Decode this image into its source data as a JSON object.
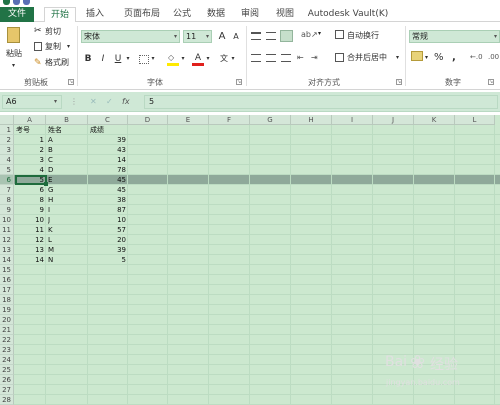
{
  "ribbon": {
    "tabs": [
      "文件",
      "开始",
      "插入",
      "页面布局",
      "公式",
      "数据",
      "审阅",
      "视图",
      "Autodesk Vault(K)"
    ],
    "clipboard": {
      "paste": "粘贴",
      "cut": "剪切",
      "copy": "复制",
      "format_painter": "格式刷",
      "label": "剪贴板"
    },
    "font": {
      "name": "宋体",
      "size": "11",
      "grow": "A",
      "shrink": "A",
      "bold": "B",
      "italic": "I",
      "underline": "U",
      "font_color_letter": "A",
      "wen": "文",
      "label": "字体"
    },
    "alignment": {
      "wrap": "自动换行",
      "merge": "合并后居中",
      "label": "对齐方式"
    },
    "number": {
      "format": "常规",
      "percent": "%",
      "comma": ",",
      "label": "数字"
    }
  },
  "formula_bar": {
    "name_box": "A6",
    "fx": "fx",
    "value": "5"
  },
  "columns": [
    "A",
    "B",
    "C",
    "D",
    "E",
    "F",
    "G",
    "H",
    "I",
    "J",
    "K",
    "L"
  ],
  "rows": [
    "1",
    "2",
    "3",
    "4",
    "5",
    "6",
    "7",
    "8",
    "9",
    "10",
    "11",
    "12",
    "13",
    "14",
    "15",
    "16",
    "17",
    "18",
    "19",
    "20",
    "21",
    "22",
    "23",
    "24",
    "25",
    "26",
    "27",
    "28"
  ],
  "headers": {
    "a1": "考号",
    "b1": "姓名",
    "c1": "成绩"
  },
  "records": [
    {
      "id": "1",
      "name": "A",
      "score": "39"
    },
    {
      "id": "2",
      "name": "B",
      "score": "43"
    },
    {
      "id": "3",
      "name": "C",
      "score": "14"
    },
    {
      "id": "4",
      "name": "D",
      "score": "78"
    },
    {
      "id": "5",
      "name": "E",
      "score": "45"
    },
    {
      "id": "6",
      "name": "G",
      "score": "45"
    },
    {
      "id": "8",
      "name": "H",
      "score": "38"
    },
    {
      "id": "9",
      "name": "I",
      "score": "87"
    },
    {
      "id": "10",
      "name": "J",
      "score": "10"
    },
    {
      "id": "11",
      "name": "K",
      "score": "57"
    },
    {
      "id": "12",
      "name": "L",
      "score": "20"
    },
    {
      "id": "13",
      "name": "M",
      "score": "39"
    },
    {
      "id": "14",
      "name": "N",
      "score": "5"
    }
  ],
  "watermark": {
    "brand": "Bai",
    "brand2": "经验",
    "url": "jingyan.baidu.com"
  }
}
